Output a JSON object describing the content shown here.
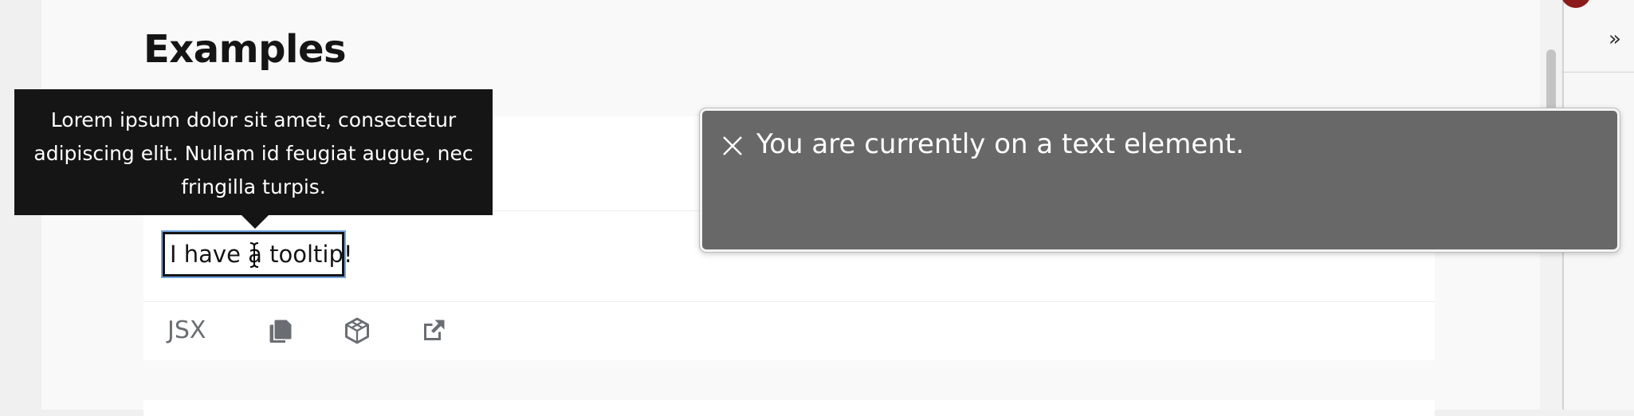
{
  "page": {
    "heading": "Examples"
  },
  "example": {
    "tooltip_text": "Lorem ipsum dolor sit amet, consectetur adipiscing elit. Nullam id feugiat augue, nec fringilla turpis.",
    "target_text": "I have a tooltip!"
  },
  "code_toolbar": {
    "jsx_label": "JSX",
    "icons": [
      "copy-icon",
      "codesandbox-icon",
      "external-link-icon"
    ]
  },
  "voiceover": {
    "message": "You are currently on a text element."
  },
  "browser": {
    "overflow_label": "»"
  },
  "colors": {
    "tooltip_bg": "#151515",
    "voiceover_bg": "#686868",
    "focus_outline": "#73a6e3",
    "icon_gray": "#6a6e73"
  }
}
